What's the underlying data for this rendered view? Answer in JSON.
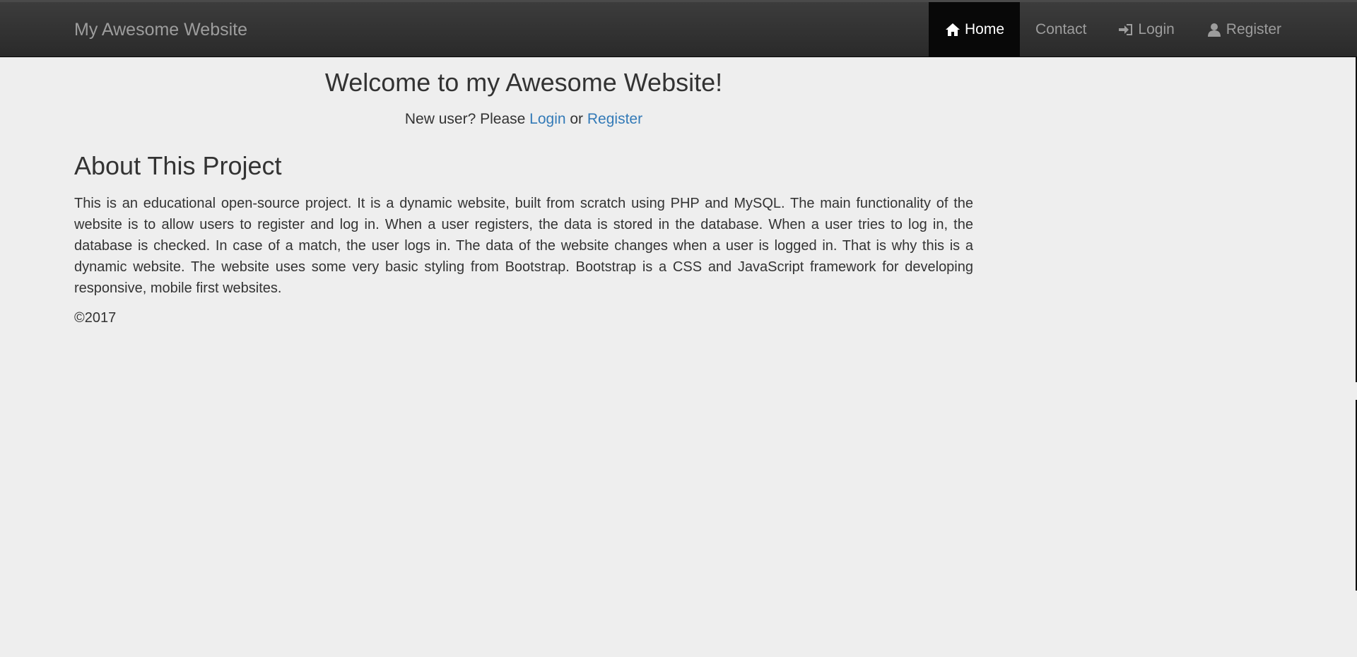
{
  "navbar": {
    "brand": "My Awesome Website",
    "items": [
      {
        "label": "Home",
        "icon": "home-icon",
        "active": true
      },
      {
        "label": "Contact",
        "icon": "",
        "active": false
      },
      {
        "label": "Login",
        "icon": "login-icon",
        "active": false
      },
      {
        "label": "Register",
        "icon": "user-icon",
        "active": false
      }
    ]
  },
  "hero": {
    "title": "Welcome to my Awesome Website!",
    "prompt_prefix": "New user? Please ",
    "login_link": "Login",
    "or_text": " or ",
    "register_link": "Register"
  },
  "about": {
    "title": "About This Project",
    "body": "This is an educational open-source project. It is a dynamic website, built from scratch using PHP and MySQL. The main functionality of the website is to allow users to register and log in. When a user registers, the data is stored in the database. When a user tries to log in, the database is checked. In case of a match, the user logs in. The data of the website changes when a user is logged in. That is why this is a dynamic website. The website uses some very basic styling from Bootstrap. Bootstrap is a CSS and JavaScript framework for developing responsive, mobile first websites."
  },
  "footer": {
    "copyright": "©2017"
  },
  "colors": {
    "navbar_bg": "#2f2f2f",
    "active_bg": "#080808",
    "link": "#337ab7",
    "page_bg": "#eeeeee"
  }
}
